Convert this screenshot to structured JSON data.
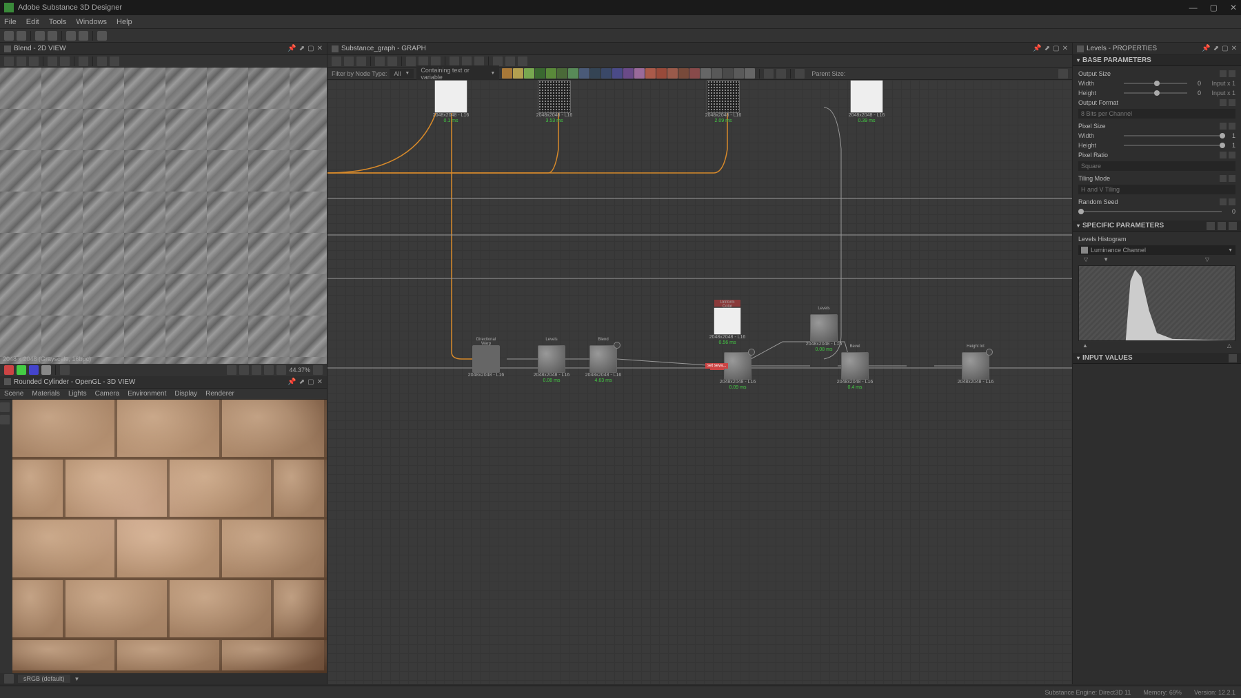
{
  "app": {
    "title": "Adobe Substance 3D Designer"
  },
  "menu": {
    "file": "File",
    "edit": "Edit",
    "tools": "Tools",
    "windows": "Windows",
    "help": "Help"
  },
  "panels": {
    "view2d": {
      "title": "Blend - 2D VIEW",
      "readout": "2048 x 2048 (Grayscale, 16bpc)",
      "zoom": "44.37%"
    },
    "view3d": {
      "title": "Rounded Cylinder - OpenGL - 3D VIEW",
      "menu": {
        "scene": "Scene",
        "materials": "Materials",
        "lights": "Lights",
        "camera": "Camera",
        "environment": "Environment",
        "display": "Display",
        "renderer": "Renderer"
      },
      "colorspace": "sRGB (default)"
    },
    "graph": {
      "title": "Substance_graph - GRAPH",
      "filter_label": "Filter by Node Type:",
      "filter_value": "All",
      "filter_text": "Containing text or variable",
      "parent_size": "Parent Size:"
    },
    "properties": {
      "title": "Levels - PROPERTIES",
      "base_params": "BASE PARAMETERS",
      "output_size": "Output Size",
      "width": "Width",
      "height": "Height",
      "width_val": "0",
      "height_val": "0",
      "width_trail": "Input x 1",
      "height_trail": "Input x 1",
      "output_format": "Output Format",
      "output_format_val": "8 Bits per Channel",
      "pixel_size": "Pixel Size",
      "px_width_val": "1",
      "px_height_val": "1",
      "pixel_ratio": "Pixel Ratio",
      "pixel_ratio_val": "Square",
      "tiling_mode": "Tiling Mode",
      "tiling_mode_val": "H and V Tiling",
      "random_seed": "Random Seed",
      "random_seed_val": "0",
      "specific_params": "SPECIFIC PARAMETERS",
      "levels_histogram": "Levels Histogram",
      "luminance": "Luminance Channel",
      "input_values": "INPUT VALUES"
    }
  },
  "nodes": {
    "top1": {
      "label": "2048x2048 - L16",
      "timing": "0.1 ms"
    },
    "top2": {
      "label": "2048x2048 - L16",
      "timing": "3.53 ms"
    },
    "top3": {
      "label": "2048x2048 - L16",
      "timing": "2.09 ms"
    },
    "top4": {
      "label": "2048x2048 - L16",
      "timing": "0.39 ms"
    },
    "uniform": {
      "title": "Uniform Color",
      "label": "2048x2048 - L16",
      "timing": "0.56 ms"
    },
    "b1": {
      "label": "2048x2048 - L16",
      "timing": ""
    },
    "b2": {
      "label": "2048x2048 - L16",
      "timing": "0.08 ms"
    },
    "b3": {
      "label": "2048x2048 - L16",
      "timing": "4.63 ms"
    },
    "b4": {
      "label": "2048x2048 - L16",
      "timing": "0.09 ms"
    },
    "b5": {
      "label": "2048x2048 - L16",
      "timing": "0.08 ms"
    },
    "b6": {
      "label": "2048x2048 - L16",
      "timing": "0.4 ms"
    },
    "b7": {
      "label": "2048x2048 - L16",
      "timing": ""
    },
    "badge": "set seva..."
  },
  "statusbar": {
    "engine": "Substance Engine: Direct3D 11",
    "memory": "Memory: 69%",
    "version": "Version: 12.2.1"
  },
  "palette_colors": [
    "#a87838",
    "#b4a050",
    "#78a850",
    "#3a6830",
    "#5a8a3a",
    "#4a6a38",
    "#588a58",
    "#4a5a78",
    "#344454",
    "#3a4868",
    "#4a4a88",
    "#6a4a88",
    "#9a6a9a",
    "#aa5a4a",
    "#994a3a",
    "#9a5a4a",
    "#784a3a",
    "#884a4a",
    "#666666",
    "#585858",
    "#4a4a4a",
    "#5a5a5a",
    "#666666"
  ]
}
